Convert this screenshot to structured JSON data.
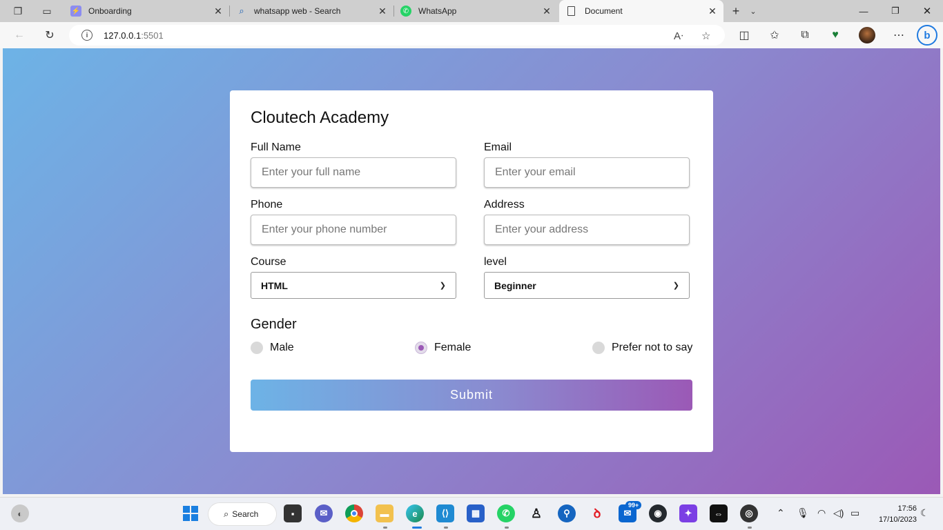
{
  "browser": {
    "tabs": [
      {
        "title": "Onboarding"
      },
      {
        "title": "whatsapp web - Search"
      },
      {
        "title": "WhatsApp"
      },
      {
        "title": "Document"
      }
    ],
    "active_tab_index": 3,
    "url_host": "127.0.0.1",
    "url_port": ":5501"
  },
  "form": {
    "title": "Cloutech Academy",
    "full_name": {
      "label": "Full Name",
      "placeholder": "Enter your full name"
    },
    "email": {
      "label": "Email",
      "placeholder": "Enter your email"
    },
    "phone": {
      "label": "Phone",
      "placeholder": "Enter your phone number"
    },
    "address": {
      "label": "Address",
      "placeholder": "Enter your address"
    },
    "course": {
      "label": "Course",
      "selected": "HTML"
    },
    "level": {
      "label": "level",
      "selected": "Beginner"
    },
    "gender": {
      "title": "Gender",
      "options": [
        "Male",
        "Female",
        "Prefer not to say"
      ],
      "selected": "Female"
    },
    "submit_label": "Submit"
  },
  "taskbar": {
    "search_label": "Search",
    "notification_badge": "99+",
    "time": "17:56",
    "date": "17/10/2023"
  },
  "colors": {
    "gradient_start": "#6db3e6",
    "gradient_end": "#9b59b6",
    "radio_accent": "#9b59b6"
  }
}
